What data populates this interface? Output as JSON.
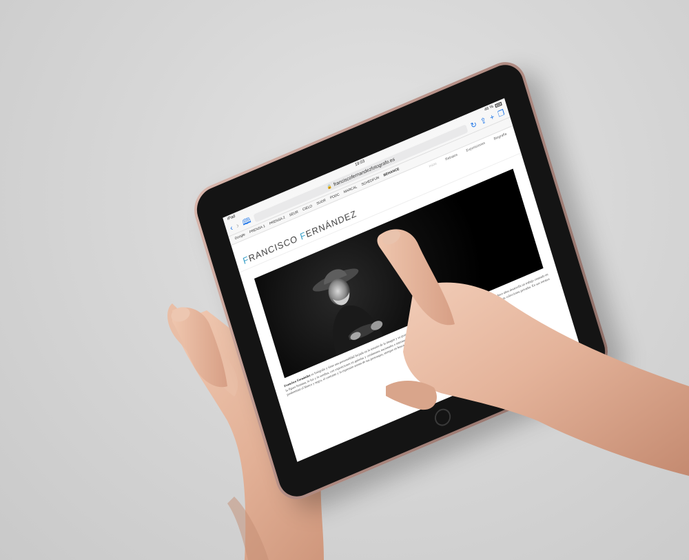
{
  "status_bar": {
    "carrier": "iPad",
    "time": "19:03",
    "battery": "46 %"
  },
  "browser": {
    "url": "franciscofernandezfotografo.es",
    "icons": [
      "back-icon",
      "forward-icon",
      "bookmarks-icon",
      "reload-icon",
      "share-icon",
      "new-tab-icon",
      "tabs-icon",
      "more-icon"
    ]
  },
  "bookmarks": [
    "Google",
    "PRENSA 1",
    "PRENSA 2",
    "SEUR",
    "CIELO",
    "SUGR",
    "PODC",
    "MARCAL",
    "SCHEDFUN",
    "BEHANCE"
  ],
  "site_nav": [
    "Inicio",
    "Retratos",
    "Exposiciones",
    "Biografía"
  ],
  "site_title": {
    "letter1": "F",
    "part1": "RANCISCO ",
    "letter2": "F",
    "part2": "ERNÁNDEZ"
  },
  "bio": {
    "name": "Francisco Fernández",
    "text": "es fotógrafo y tiene una personalidad forjada en la tensión de la imagen y su propia mirada, un sencillo estudio donde el retrato se convierte en diálogo. Desde hace años desarrolla un trabajo centrado en la figura humana, la luz y la sombra, con exposiciones en galerías y certámenes nacionales e internacionales. Su obra ha sido publicada en revistas y catálogos, y forma parte de diversas colecciones privadas. En sus retratos predominan el blanco y negro, el contraste y la expresión serena de sus personajes, siempre en busca de la verdad que esconde cada rostro."
  },
  "colors": {
    "accent": "#3aa0c8",
    "ios_blue": "#1a73e8",
    "background": "#d7d7d7",
    "rim": "#c09a91"
  }
}
